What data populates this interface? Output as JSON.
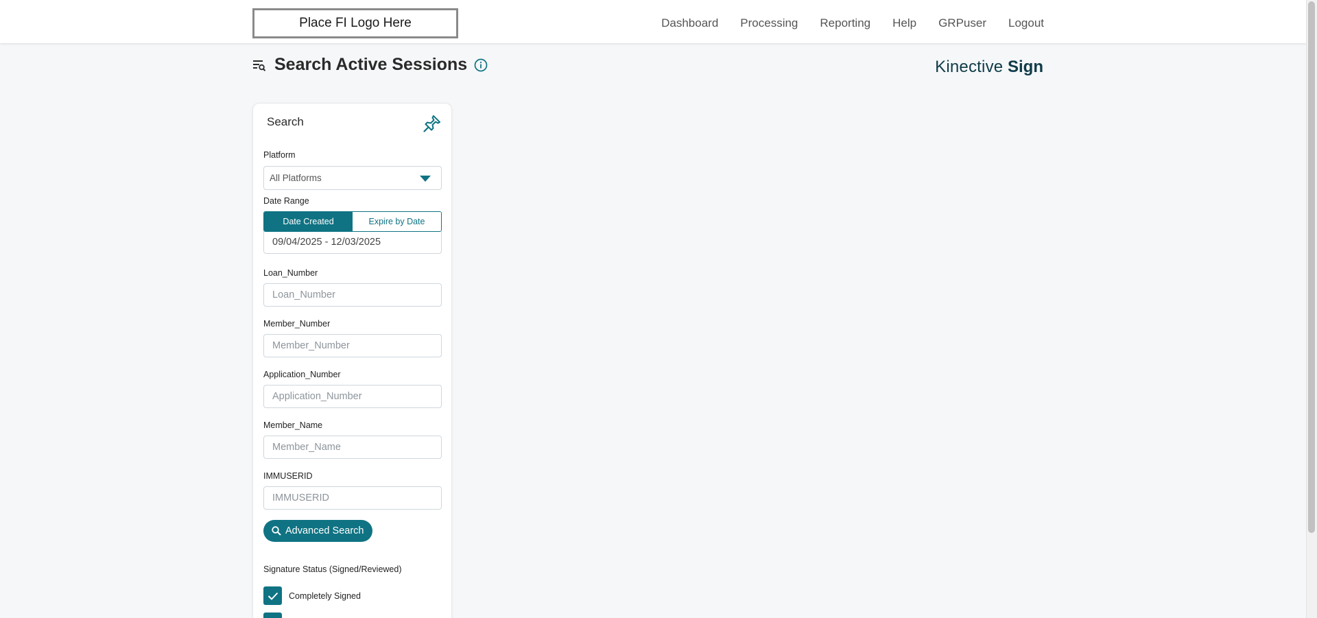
{
  "header": {
    "logo_text": "Place FI Logo Here",
    "nav": [
      "Dashboard",
      "Processing",
      "Reporting",
      "Help",
      "GRPuser",
      "Logout"
    ]
  },
  "page": {
    "title": "Search Active Sessions",
    "brand_light": "Kinective",
    "brand_bold": "Sign"
  },
  "search_panel": {
    "title": "Search",
    "platform": {
      "label": "Platform",
      "value": "All Platforms"
    },
    "date_range": {
      "label": "Date Range",
      "option_active": "Date Created",
      "option_inactive": "Expire by Date",
      "value": "09/04/2025 - 12/03/2025"
    },
    "fields": [
      {
        "label": "Loan_Number",
        "placeholder": "Loan_Number"
      },
      {
        "label": "Member_Number",
        "placeholder": "Member_Number"
      },
      {
        "label": "Application_Number",
        "placeholder": "Application_Number"
      },
      {
        "label": "Member_Name",
        "placeholder": "Member_Name"
      },
      {
        "label": "IMMUSERID",
        "placeholder": "IMMUSERID"
      }
    ],
    "advanced_search_label": "Advanced Search",
    "signature_status": {
      "label": "Signature Status (Signed/Reviewed)",
      "options": [
        {
          "label": "Completely Signed",
          "checked": true
        },
        {
          "label": "",
          "checked": true
        }
      ]
    }
  },
  "colors": {
    "accent": "#0f7383",
    "brand_text": "#0f3b47",
    "background": "#f5f7f9"
  }
}
